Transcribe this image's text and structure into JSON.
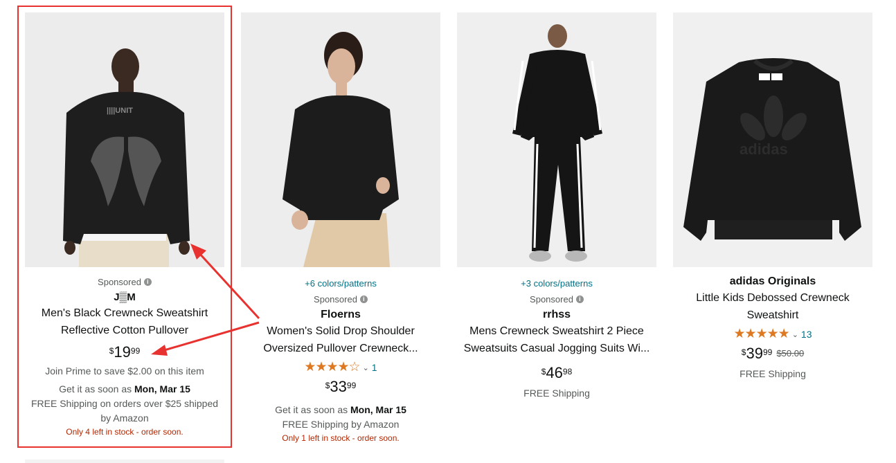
{
  "colors": {
    "highlight": "#e8322f",
    "star": "#de7921",
    "link": "#007185",
    "alert": "#b12704"
  },
  "products": [
    {
      "image_icon": "black-sweatshirt-wings-back-photo",
      "sponsored": "Sponsored",
      "brand": "J▒M",
      "title": "Men's Black Crewneck Sweatshirt Reflective Cotton Pullover",
      "price_symbol": "$",
      "price_whole": "19",
      "price_fraction": "99",
      "prime": "Join Prime to save $2.00 on this item",
      "delivery_prefix": "Get it as soon as",
      "delivery_date": "Mon, Mar 15",
      "shipping": "FREE Shipping on orders over $25 shipped by Amazon",
      "stock": "Only 4 left in stock - order soon."
    },
    {
      "image_icon": "woman-black-pullover-photo",
      "colors": "+6 colors/patterns",
      "sponsored": "Sponsored",
      "brand": "Floerns",
      "title": "Women's Solid Drop Shoulder Oversized Pullover Crewneck...",
      "stars": "★★★★☆",
      "rating_count": "1",
      "rating": 4,
      "price_symbol": "$",
      "price_whole": "33",
      "price_fraction": "99",
      "delivery_prefix": "Get it as soon as",
      "delivery_date": "Mon, Mar 15",
      "shipping": "FREE Shipping by Amazon",
      "stock": "Only 1 left in stock - order soon."
    },
    {
      "image_icon": "man-black-tracksuit-photo",
      "colors": "+3 colors/patterns",
      "sponsored": "Sponsored",
      "brand": "rrhss",
      "title": "Mens Crewneck Sweatshirt 2 Piece Sweatsuits Casual Jogging Suits Wi...",
      "price_symbol": "$",
      "price_whole": "46",
      "price_fraction": "98",
      "shipping": "FREE Shipping"
    },
    {
      "image_icon": "adidas-black-sweatshirt-photo",
      "brand": "adidas Originals",
      "title": "Little Kids Debossed Crewneck Sweatshirt",
      "stars": "★★★★★",
      "rating_count": "13",
      "rating": 4.5,
      "price_symbol": "$",
      "price_whole": "39",
      "price_fraction": "99",
      "list_price": "$50.00",
      "shipping": "FREE Shipping",
      "logo_text": "adidas"
    }
  ]
}
